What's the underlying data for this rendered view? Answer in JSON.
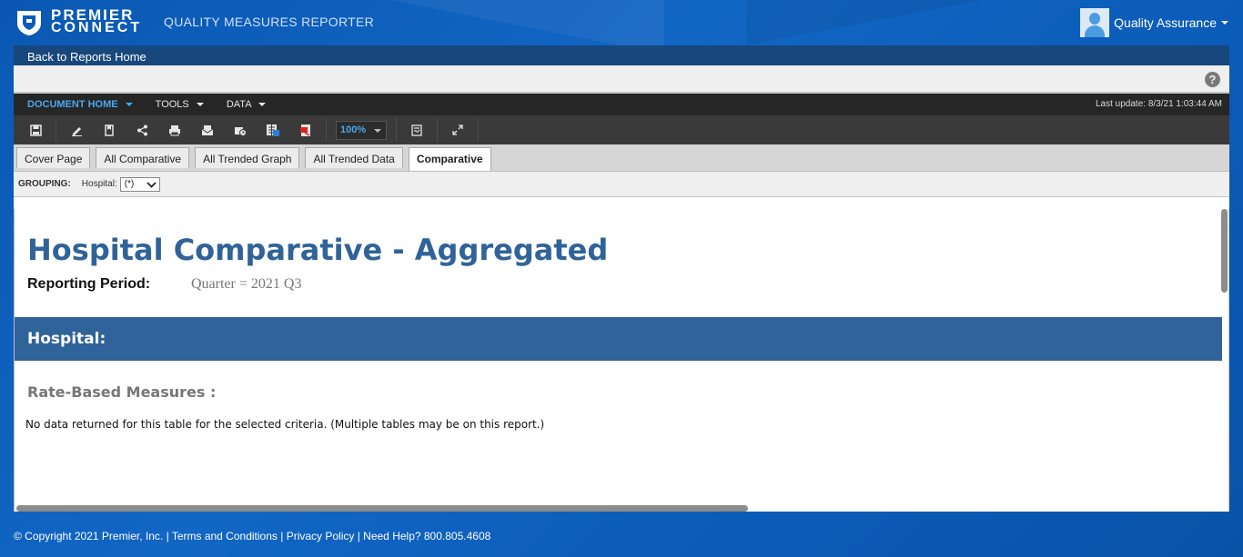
{
  "brand": {
    "logo_line1": "PREMIER",
    "logo_line2": "CONNECT",
    "app_title": "QUALITY MEASURES REPORTER"
  },
  "user": {
    "name": "Quality Assurance"
  },
  "nav": {
    "back_label": "Back to Reports Home"
  },
  "menu": {
    "items": [
      {
        "label": "DOCUMENT HOME"
      },
      {
        "label": "TOOLS"
      },
      {
        "label": "DATA"
      }
    ],
    "last_update": "Last update: 8/3/21 1:03:44 AM"
  },
  "toolbar": {
    "zoom": "100%",
    "icons": [
      "save-icon",
      "edit-icon",
      "bookmark-icon",
      "share-icon",
      "print-icon",
      "email-icon",
      "schedule-icon",
      "export-excel-icon",
      "export-pdf-icon",
      "fit-page-icon",
      "fullscreen-icon"
    ]
  },
  "tabs": [
    {
      "label": "Cover Page"
    },
    {
      "label": "All Comparative"
    },
    {
      "label": "All Trended Graph"
    },
    {
      "label": "All Trended Data"
    },
    {
      "label": "Comparative"
    }
  ],
  "grouping": {
    "label": "GROUPING:",
    "field_label": "Hospital:",
    "field_value": "(*)"
  },
  "report": {
    "title": "Hospital Comparative - Aggregated",
    "period_label": "Reporting Period:",
    "period_value": "Quarter = 2021 Q3",
    "hospital_label": "Hospital:",
    "section_title": "Rate-Based Measures :",
    "no_data_message": "No data returned for this table for the selected criteria. (Multiple tables may be on this report.)"
  },
  "footer": {
    "copyright": "© Copyright 2021 Premier, Inc.",
    "terms": "Terms and Conditions",
    "privacy": "Privacy Policy",
    "help": "Need Help? 800.805.4608"
  },
  "colors": {
    "background": "#0b5cb8",
    "nav_dark": "#17477c",
    "report_blue": "#2f6399",
    "menu_active": "#4aa7f0"
  }
}
